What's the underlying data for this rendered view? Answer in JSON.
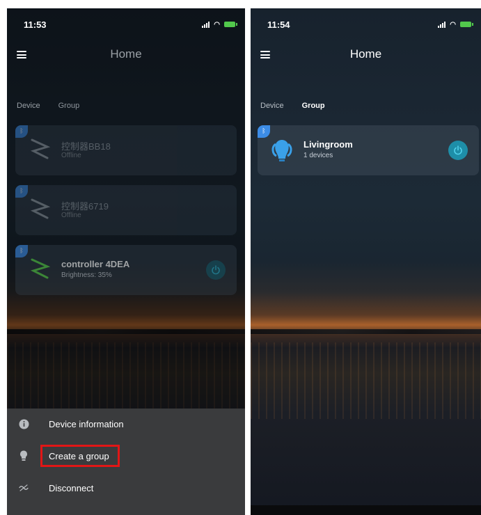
{
  "screens": [
    {
      "time": "11:53",
      "title": "Home",
      "tabs": [
        {
          "label": "Device",
          "active": true
        },
        {
          "label": "Group",
          "active": false
        }
      ],
      "devices": [
        {
          "name": "控制器BB18",
          "status": "Offline",
          "icon": "led-strip-icon",
          "accent": "#9aa3ab"
        },
        {
          "name": "控制器6719",
          "status": "Offline",
          "icon": "led-strip-icon",
          "accent": "#9aa3ab"
        },
        {
          "name": "controller 4DEA",
          "status": "Brightness: 35%",
          "icon": "led-strip-icon",
          "accent": "#59d14a"
        }
      ],
      "menu": [
        {
          "label": "Device information",
          "icon": "info-icon"
        },
        {
          "label": "Create a group",
          "icon": "bulb-icon"
        },
        {
          "label": "Disconnect",
          "icon": "disconnect-icon"
        }
      ]
    },
    {
      "time": "11:54",
      "title": "Home",
      "tabs": [
        {
          "label": "Device",
          "active": false
        },
        {
          "label": "Group",
          "active": true
        }
      ],
      "groups": [
        {
          "name": "Livingroom",
          "status": "1 devices",
          "icon": "light-bulb-icon",
          "accent": "#3aa0e8"
        }
      ]
    }
  ],
  "colors": {
    "accent": "#1e8ea8",
    "badge": "#3c8ce6",
    "highlight": "#e21616"
  }
}
